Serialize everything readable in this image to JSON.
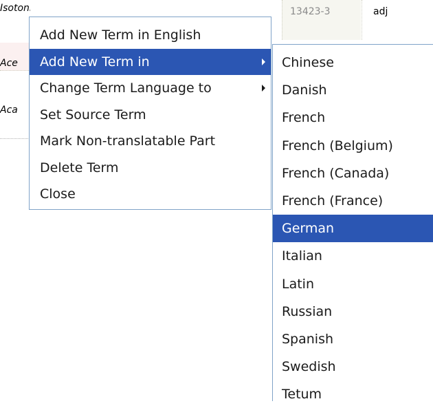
{
  "background": {
    "rows": [
      {
        "term": "Isotonic"
      },
      {
        "term": "Ace"
      },
      {
        "term": "Aca"
      }
    ],
    "id_value": "13423-3",
    "pos_value": "adj"
  },
  "context_menu": {
    "items": [
      {
        "label": "Add New Term in English",
        "has_submenu": false,
        "selected": false
      },
      {
        "label": "Add New Term in",
        "has_submenu": true,
        "selected": true
      },
      {
        "label": "Change Term Language to",
        "has_submenu": true,
        "selected": false
      },
      {
        "label": "Set Source Term",
        "has_submenu": false,
        "selected": false
      },
      {
        "label": "Mark Non-translatable Part",
        "has_submenu": false,
        "selected": false
      },
      {
        "label": "Delete Term",
        "has_submenu": false,
        "selected": false
      },
      {
        "label": "Close",
        "has_submenu": false,
        "selected": false
      }
    ]
  },
  "language_submenu": {
    "items": [
      {
        "label": "Chinese",
        "selected": false
      },
      {
        "label": "Danish",
        "selected": false
      },
      {
        "label": "French",
        "selected": false
      },
      {
        "label": "French (Belgium)",
        "selected": false
      },
      {
        "label": "French (Canada)",
        "selected": false
      },
      {
        "label": "French (France)",
        "selected": false
      },
      {
        "label": "German",
        "selected": true
      },
      {
        "label": "Italian",
        "selected": false
      },
      {
        "label": "Latin",
        "selected": false
      },
      {
        "label": "Russian",
        "selected": false
      },
      {
        "label": "Spanish",
        "selected": false
      },
      {
        "label": "Swedish",
        "selected": false
      },
      {
        "label": "Tetum",
        "selected": false
      }
    ]
  },
  "colors": {
    "selection": "#2b56b3",
    "menu_border": "#7fa3c8",
    "id_cell_bg": "#f6f6f0"
  }
}
